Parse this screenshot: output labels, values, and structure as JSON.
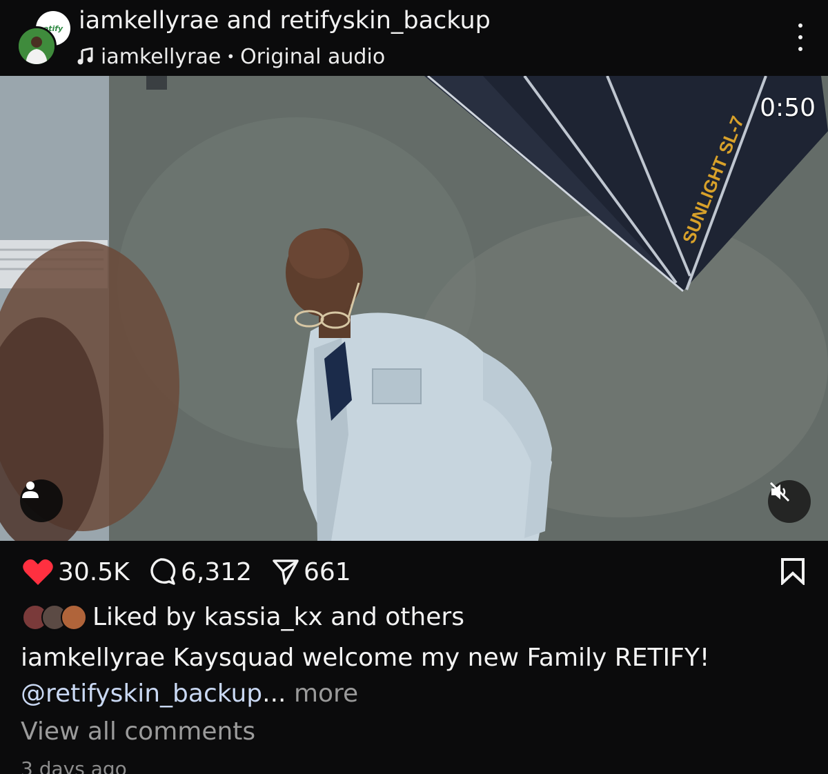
{
  "header": {
    "title": "iamkellyrae and retifyskin_backup",
    "audio_author": "iamkellyrae",
    "audio_separator": "•",
    "audio_label": "Original audio",
    "collab_logo_text": "etify"
  },
  "video": {
    "timecode": "0:50",
    "softbox_brand": "SUNLIGHT SL-7"
  },
  "actions": {
    "likes": "30.5K",
    "comments": "6,312",
    "shares": "661"
  },
  "liked_by": {
    "text": "Liked by kassia_kx and others"
  },
  "caption": {
    "username": "iamkellyrae",
    "text": "Kaysquad welcome my new Family RETIFY!",
    "mention": "@retifyskin_backup",
    "ellipsis": "...",
    "more_label": "more"
  },
  "view_all_comments": "View all comments",
  "time_ago": "3 days ago",
  "colors": {
    "background": "#0b0b0c",
    "heart": "#ff3040",
    "mention": "#c9d8f3",
    "muted_text": "#9b9b9b"
  },
  "icons": [
    "music-note-icon",
    "more-vertical-icon",
    "user-tag-icon",
    "muted-speaker-icon",
    "heart-icon",
    "comment-icon",
    "share-icon",
    "bookmark-icon"
  ]
}
